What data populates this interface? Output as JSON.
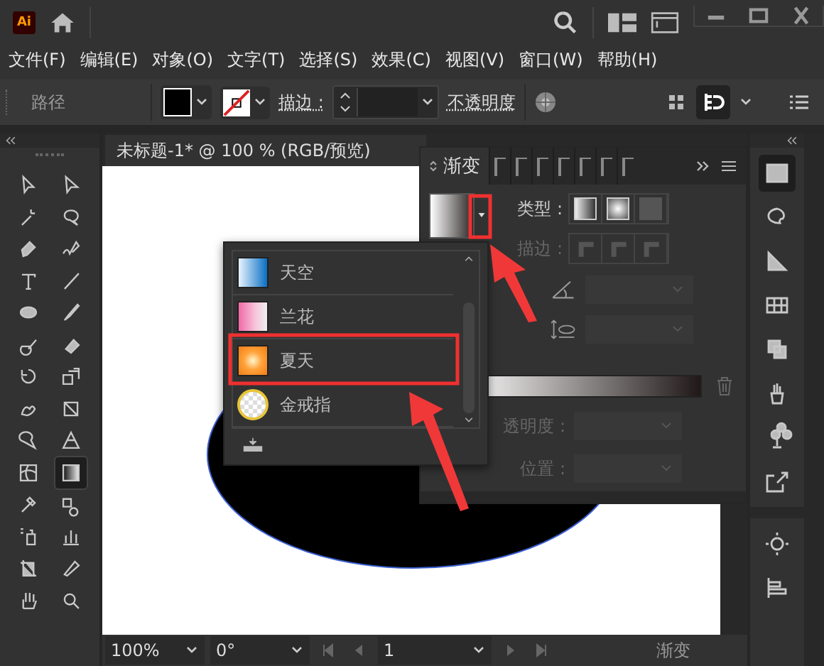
{
  "app": {
    "logo": "Ai"
  },
  "menu": [
    "文件(F)",
    "编辑(E)",
    "对象(O)",
    "文字(T)",
    "选择(S)",
    "效果(C)",
    "视图(V)",
    "窗口(W)",
    "帮助(H)"
  ],
  "control_bar": {
    "object_label": "路径",
    "stroke_label": "描边 :",
    "opacity_label": "不透明度"
  },
  "document_tab": {
    "title": "未标题-1* @ 100 % (RGB/预览)"
  },
  "tools": [
    {
      "selected": false
    },
    {
      "selected": false
    },
    {
      "selected": false
    },
    {
      "selected": false
    },
    {
      "selected": false
    },
    {
      "selected": false
    },
    {
      "selected": false
    },
    {
      "selected": false
    },
    {
      "selected": false
    },
    {
      "selected": false
    },
    {
      "selected": false
    },
    {
      "selected": false
    },
    {
      "selected": false
    },
    {
      "selected": false
    },
    {
      "selected": false
    },
    {
      "selected": false
    },
    {
      "selected": false
    },
    {
      "selected": false
    },
    {
      "selected": false
    },
    {
      "selected": true
    },
    {
      "selected": false
    },
    {
      "selected": false
    },
    {
      "selected": false
    },
    {
      "selected": false
    },
    {
      "selected": false
    },
    {
      "selected": false
    },
    {
      "selected": false
    },
    {
      "selected": false
    }
  ],
  "gradient_panel": {
    "tab": "渐变",
    "type_label": "类型 :",
    "stroke_label": "描边 :",
    "opacity_label": "透明度 :",
    "position_label": "位置 :"
  },
  "presets_dropdown": {
    "items": [
      {
        "name": "天空",
        "kind": "sky"
      },
      {
        "name": "兰花",
        "kind": "orchid"
      },
      {
        "name": "夏天",
        "kind": "summer"
      },
      {
        "name": "金戒指",
        "kind": "gold"
      }
    ]
  },
  "status_bar": {
    "zoom": "100%",
    "rotation": "0°",
    "page": "1",
    "collapsed_panel": "渐变"
  }
}
